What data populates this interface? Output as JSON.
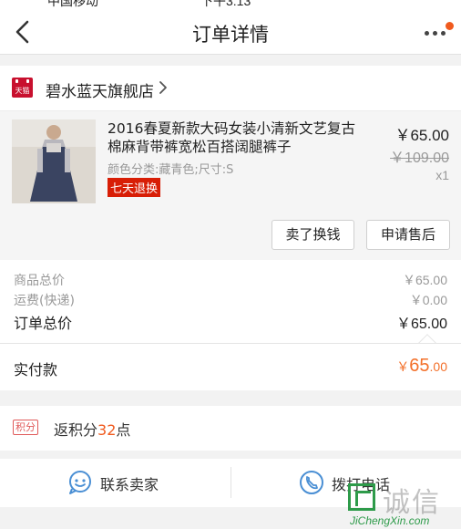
{
  "status_bar": {
    "carrier": "中国移动",
    "time": "下午3:13"
  },
  "header": {
    "title": "订单详情",
    "back_icon": "chevron-left-icon",
    "more_icon": "more-dots-icon",
    "notification_color": "#f05a1e"
  },
  "shop": {
    "badge": "天猫",
    "name": "碧水蓝天旗舰店",
    "badge_color": "#c8102e"
  },
  "product": {
    "title": "2016春夏新款大码女装小清新文艺复古棉麻背带裤宽松百搭阔腿裤子",
    "spec": "颜色分类:藏青色;尺寸:S",
    "badge": "七天退换",
    "price": "￥65.00",
    "original_price": "￥109.00",
    "quantity": "x1",
    "buttons": {
      "exchange": "卖了换钱",
      "after_sale": "申请售后"
    }
  },
  "summary": {
    "goods_total": {
      "label": "商品总价",
      "value": "￥65.00"
    },
    "shipping": {
      "label": "运费(快递)",
      "value": "￥0.00"
    },
    "order_total": {
      "label": "订单总价",
      "value": "￥65.00"
    }
  },
  "payment": {
    "label": "实付款",
    "currency": "￥",
    "amount_int": "65",
    "amount_dec": ".00",
    "accent_color": "#f3702a"
  },
  "points": {
    "badge": "积分",
    "prefix": "返积分",
    "value": "32",
    "suffix": "点"
  },
  "contact": {
    "seller_label": "联系卖家",
    "phone_label": "拨打电话",
    "seller_icon": "chat-bubble-icon",
    "phone_icon": "phone-icon"
  },
  "watermark": {
    "cn": "诚信",
    "en": "JiChengXin.com"
  }
}
